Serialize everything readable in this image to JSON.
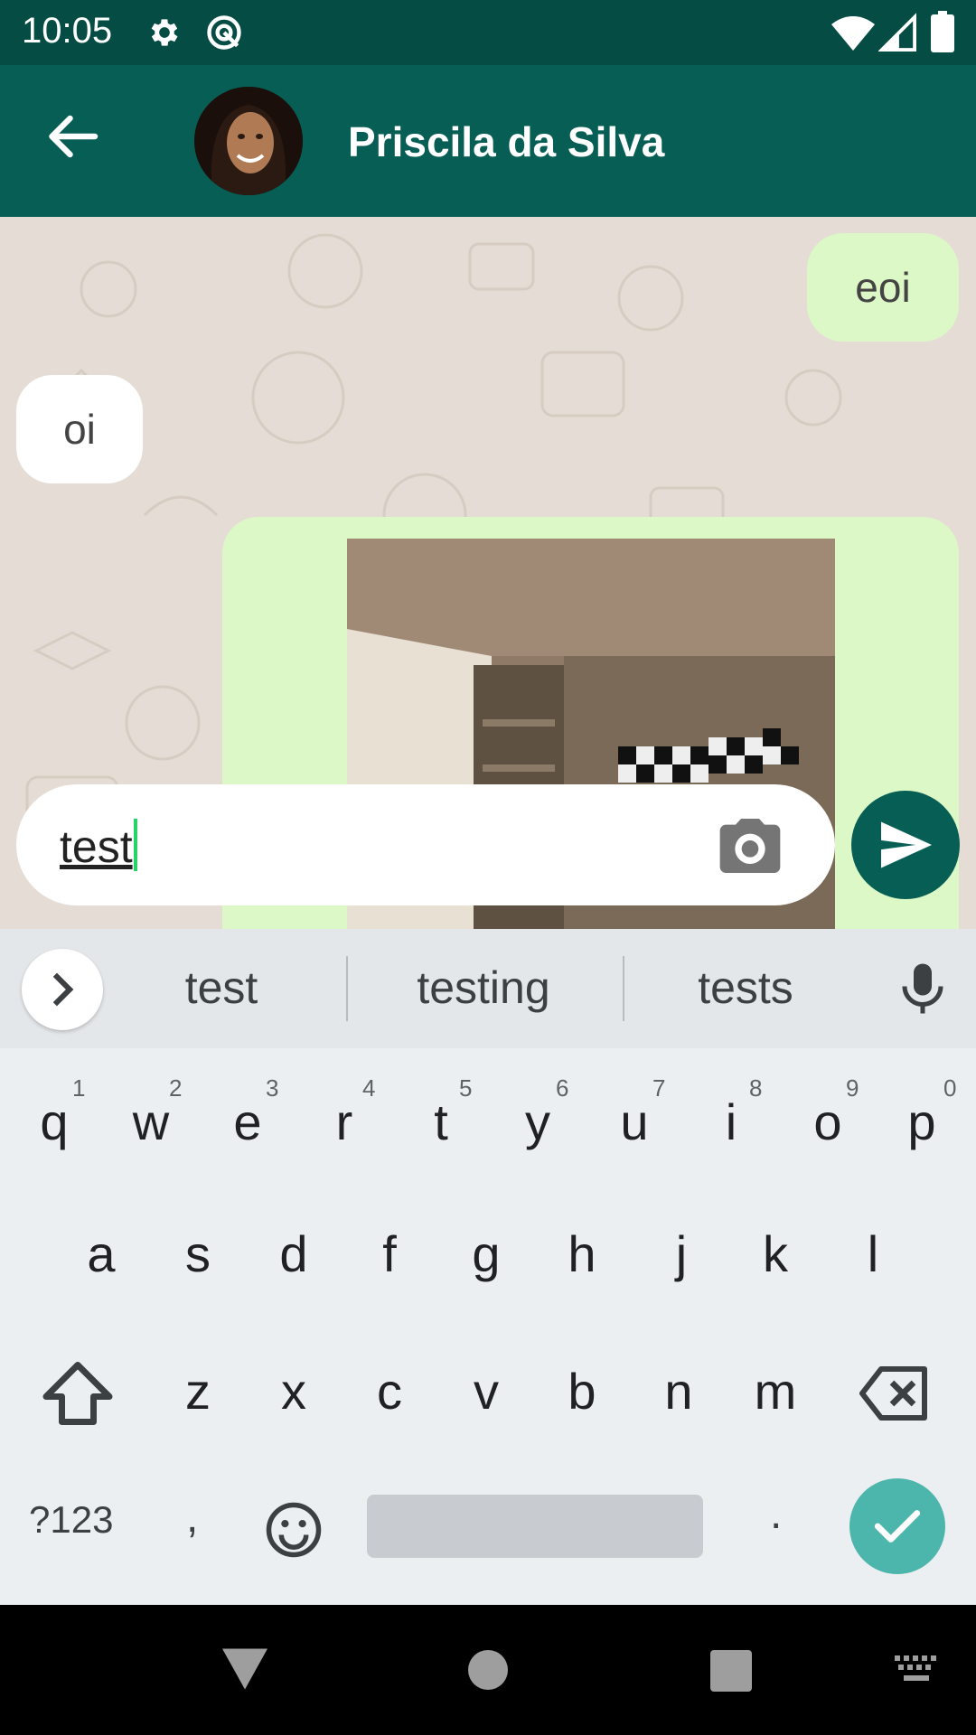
{
  "status_bar": {
    "time": "10:05",
    "icons": [
      "gear-icon",
      "assistant-icon",
      "wifi-icon",
      "signal-icon",
      "battery-icon"
    ]
  },
  "header": {
    "contact_name": "Priscila da Silva",
    "icons": [
      "back-arrow-icon",
      "avatar"
    ]
  },
  "messages": [
    {
      "direction": "outgoing",
      "text": "eoi"
    },
    {
      "direction": "incoming",
      "text": "oi"
    },
    {
      "direction": "outgoing",
      "type": "image"
    }
  ],
  "composer": {
    "value": "test",
    "icons": [
      "camera-icon",
      "send-icon"
    ]
  },
  "keyboard": {
    "suggestions": [
      "test",
      "testing",
      "tests"
    ],
    "row1": [
      {
        "key": "q",
        "hint": "1"
      },
      {
        "key": "w",
        "hint": "2"
      },
      {
        "key": "e",
        "hint": "3"
      },
      {
        "key": "r",
        "hint": "4"
      },
      {
        "key": "t",
        "hint": "5"
      },
      {
        "key": "y",
        "hint": "6"
      },
      {
        "key": "u",
        "hint": "7"
      },
      {
        "key": "i",
        "hint": "8"
      },
      {
        "key": "o",
        "hint": "9"
      },
      {
        "key": "p",
        "hint": "0"
      }
    ],
    "row2": [
      "a",
      "s",
      "d",
      "f",
      "g",
      "h",
      "j",
      "k",
      "l"
    ],
    "row3": [
      "z",
      "x",
      "c",
      "v",
      "b",
      "n",
      "m"
    ],
    "symbols_label": "?123",
    "comma": ",",
    "period": ".",
    "colors": {
      "enter": "#4db6ac",
      "background": "#eceff1"
    }
  },
  "colors": {
    "app_bar": "#075e54",
    "status_bar": "#054d44",
    "outgoing_bubble": "#dcf8c6",
    "incoming_bubble": "#ffffff",
    "chat_background": "#e5ddd5",
    "cursor": "#25d366"
  }
}
